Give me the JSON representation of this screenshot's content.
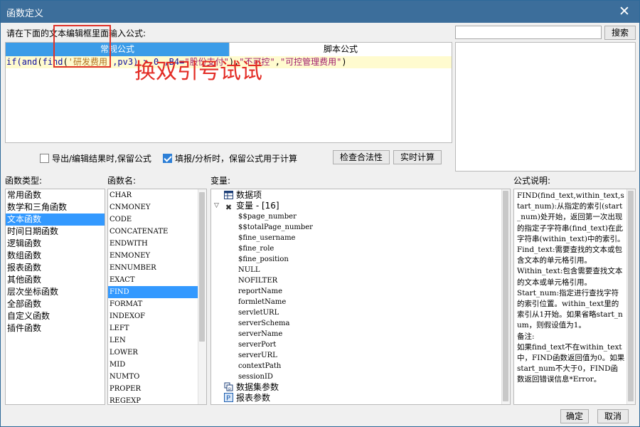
{
  "window": {
    "title": "函数定义",
    "close": "✕"
  },
  "prompt_label": "请在下面的文本编辑框里面输入公式:",
  "search": {
    "value": "",
    "button": "搜索"
  },
  "tabs": {
    "active": "常规公式",
    "inactive": "脚本公式"
  },
  "formula": {
    "p1": "if(",
    "p2": "and",
    "p3": "(",
    "p4": "find",
    "p5": "(",
    "p6": "'研发费用'",
    "p7": ",pv3) > 0 ,B4=",
    "p8": "\"股份支付\"",
    "p9": "),",
    "p10": "\"不可控\"",
    "p11": ",",
    "p12": "\"可控管理费用\"",
    "p13": ")"
  },
  "annotation": "换双引号试试",
  "options": {
    "export_keep": {
      "label": "导出/编辑结果时,保留公式",
      "checked": false
    },
    "fill_keep": {
      "label": "填报/分析时，保留公式用于计算",
      "checked": true
    },
    "check_button": "检查合法性",
    "realtime_button": "实时计算"
  },
  "headers": {
    "func_type": "函数类型:",
    "func_name": "函数名:",
    "variables": "变量:",
    "description": "公式说明:"
  },
  "func_types": [
    "常用函数",
    "数学和三角函数",
    "文本函数",
    "时间日期函数",
    "逻辑函数",
    "数组函数",
    "报表函数",
    "其他函数",
    "层次坐标函数",
    "全部函数",
    "自定义函数",
    "插件函数"
  ],
  "func_type_selected": 2,
  "func_names": [
    "CHAR",
    "CNMONEY",
    "CODE",
    "CONCATENATE",
    "ENDWITH",
    "ENMONEY",
    "ENNUMBER",
    "EXACT",
    "FIND",
    "FORMAT",
    "INDEXOF",
    "LEFT",
    "LEN",
    "LOWER",
    "MID",
    "NUMTO",
    "PROPER",
    "REGEXP"
  ],
  "func_name_selected": 8,
  "variables": {
    "data_item": "数据项",
    "var_group": "变量 - [16]",
    "children": [
      "$$page_number",
      "$$totalPage_number",
      "$fine_username",
      "$fine_role",
      "$fine_position",
      "NULL",
      "NOFILTER",
      "reportName",
      "formletName",
      "servletURL",
      "serverSchema",
      "serverName",
      "serverPort",
      "serverURL",
      "contextPath",
      "sessionID"
    ],
    "dataset_params": "数据集参数",
    "report_params": "报表参数"
  },
  "description": "FIND(find_text,within_text,start_num):从指定的索引(start_num)处开始，返回第一次出现的指定子字符串(find_text)在此字符串(within_text)中的索引。\nFind_text:需要查找的文本或包含文本的单元格引用。\nWithin_text:包含需要查找文本的文本或单元格引用。\nStart_num:指定进行查找字符的索引位置。within_text里的索引从1开始。如果省略start_num，则假设值为1。\n备注:\n如果find_text不在within_text中，FIND函数返回值为0。如果start_num不大于0，FIND函数返回错误信息*Error。",
  "footer": {
    "ok": "确定",
    "cancel": "取消"
  },
  "colors": {
    "title_bar": "#3c6e9b",
    "tab_active": "#3b9ce8",
    "selection": "#3399ff",
    "annotation": "#e32c25",
    "formula_bg": "#fffbcf"
  }
}
